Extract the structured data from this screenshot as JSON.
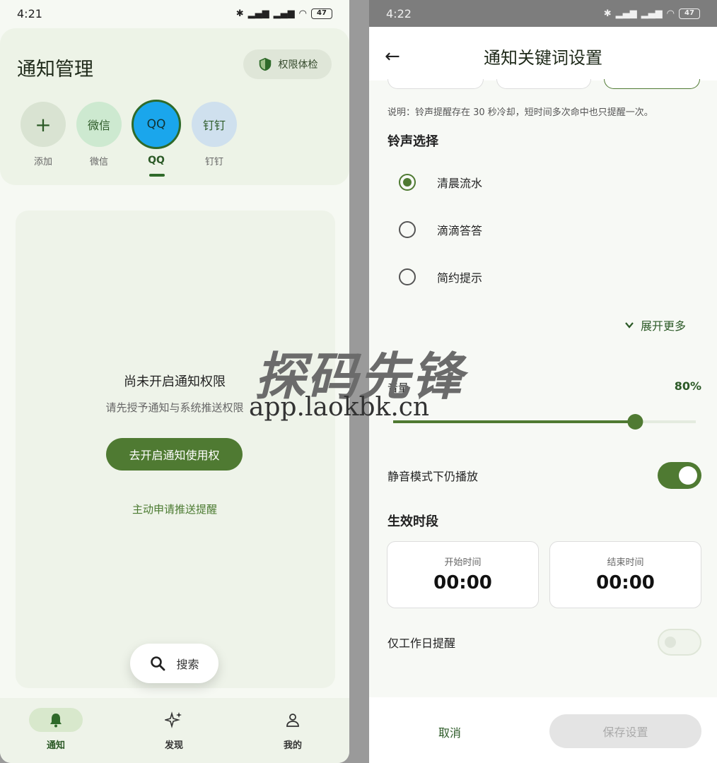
{
  "left": {
    "status_time": "4:21",
    "battery": "47",
    "title": "通知管理",
    "permission_button": "权限体检",
    "apps": [
      {
        "icon_text": "+",
        "label": "添加"
      },
      {
        "icon_text": "微信",
        "label": "微信"
      },
      {
        "icon_text": "QQ",
        "label": "QQ"
      },
      {
        "icon_text": "钉钉",
        "label": "钉钉"
      }
    ],
    "empty_title": "尚未开启通知权限",
    "empty_subtitle": "请先授予通知与系统推送权限",
    "primary_button": "去开启通知使用权",
    "link": "主动申请推送提醒",
    "search_label": "搜索",
    "nav": [
      {
        "label": "通知",
        "icon": "bell-icon"
      },
      {
        "label": "发现",
        "icon": "sparkle-icon"
      },
      {
        "label": "我的",
        "icon": "person-icon"
      }
    ]
  },
  "right": {
    "status_time": "4:22",
    "battery": "47",
    "title": "通知关键词设置",
    "note": "说明：铃声提醒存在 30 秒冷却，短时间多次命中也只提醒一次。",
    "ringtone_section": "铃声选择",
    "ringtones": [
      {
        "label": "清晨流水",
        "selected": true
      },
      {
        "label": "滴滴答答",
        "selected": false
      },
      {
        "label": "简约提示",
        "selected": false
      }
    ],
    "expand_more": "展开更多",
    "volume_label": "音量",
    "volume_percent": "80%",
    "volume_value": 0.8,
    "silent_mode_label": "静音模式下仍播放",
    "silent_mode_on": true,
    "active_period_section": "生效时段",
    "start_label": "开始时间",
    "start_value": "00:00",
    "end_label": "结束时间",
    "end_value": "00:00",
    "workday_label": "仅工作日提醒",
    "workday_on": false,
    "cancel_button": "取消",
    "save_button": "保存设置"
  },
  "watermark": {
    "brand": "探码先锋",
    "url": "app.laokbk.cn"
  },
  "colors": {
    "accent": "#4f7a32",
    "qq_blue": "#1aa6ec"
  }
}
